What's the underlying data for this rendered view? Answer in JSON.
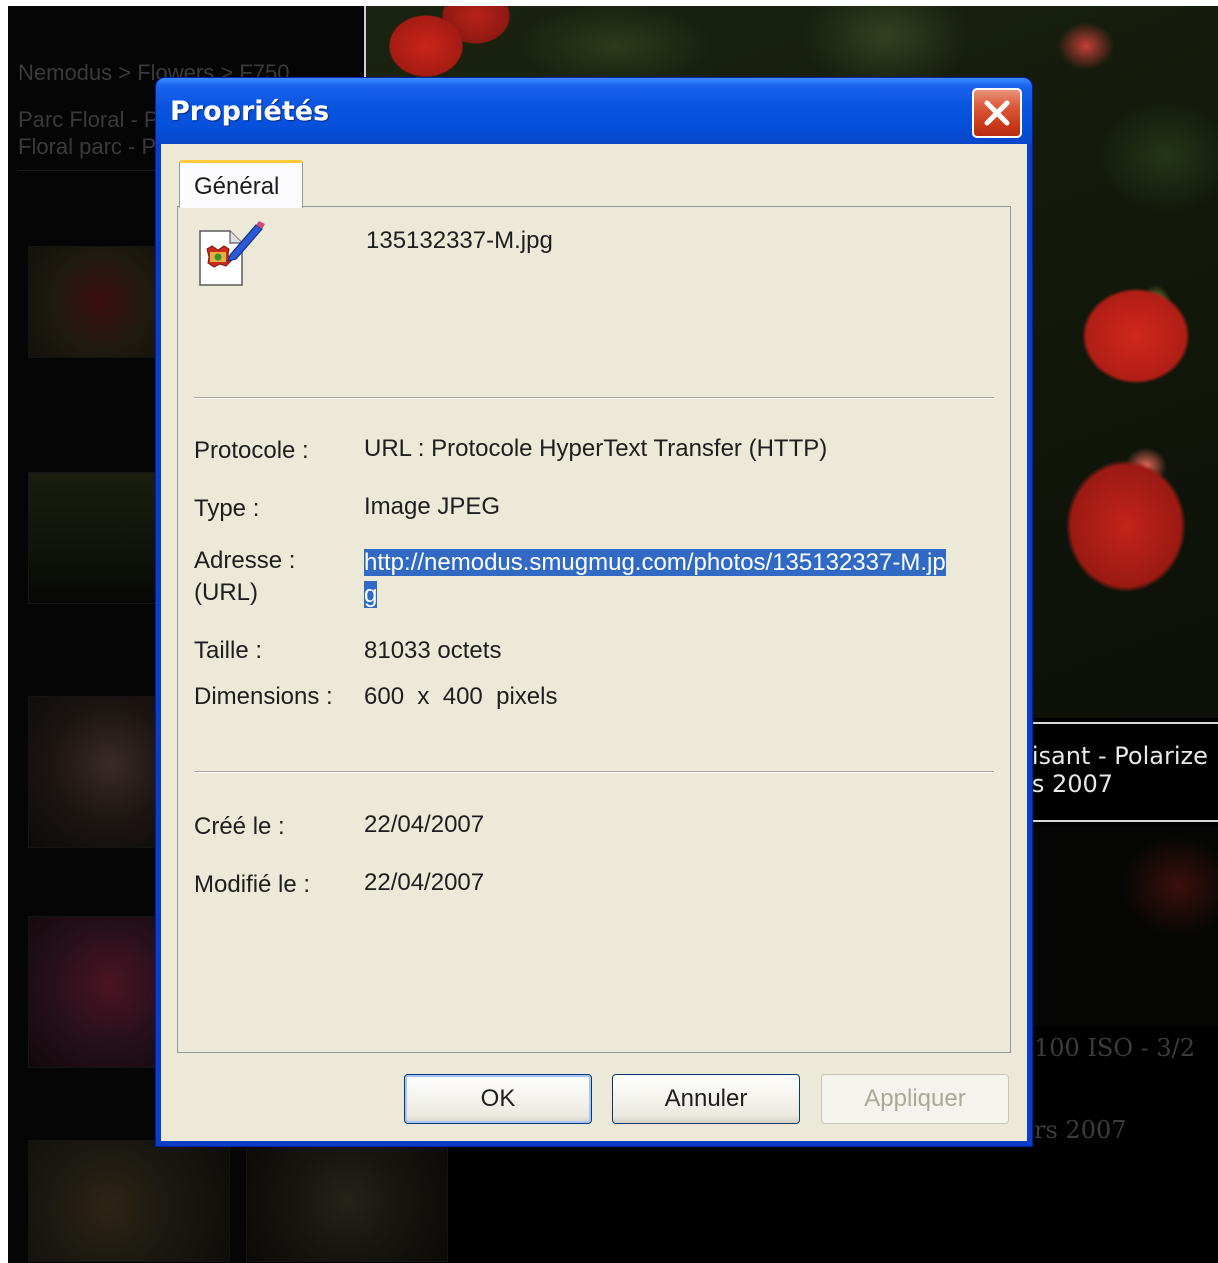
{
  "background": {
    "gallery_title": "Nemodus > Flowers > F750",
    "gallery_desc_1": "Parc Floral - Paris",
    "gallery_desc_2": "Floral parc - Paris",
    "photo_caption_1": "risant - Polarize",
    "photo_caption_2": "rs 2007",
    "exif_1": "100 ISO - 3/2",
    "exif_2": "rs 2007"
  },
  "dialog": {
    "title": "Propriétés",
    "close_icon": "close-x-icon",
    "tab_label": "Général",
    "file_icon": "jpeg-image-file-icon",
    "file_name": "135132337-M.jpg",
    "properties": {
      "protocol_label": "Protocole :",
      "protocol_value": "URL : Protocole HyperText Transfer (HTTP)",
      "type_label": "Type :",
      "type_value": "Image JPEG",
      "address_label": "Adresse : (URL)",
      "address_value": "http://nemodus.smugmug.com/photos/135132337-M.jpg",
      "size_label": "Taille :",
      "size_value": "81033 octets",
      "dimensions_label": "Dimensions :",
      "dimensions_value": "600  x  400  pixels",
      "created_label": "Créé le :",
      "created_value": "22/04/2007",
      "modified_label": "Modifié le :",
      "modified_value": "22/04/2007"
    },
    "buttons": {
      "ok": "OK",
      "cancel": "Annuler",
      "apply": "Appliquer"
    }
  },
  "colors": {
    "titlebar": "#0a55e0",
    "client_bg": "#ece9d8",
    "selection": "#316ac5",
    "close_button": "#dc5a3a",
    "tab_highlight": "#ffc83c"
  }
}
